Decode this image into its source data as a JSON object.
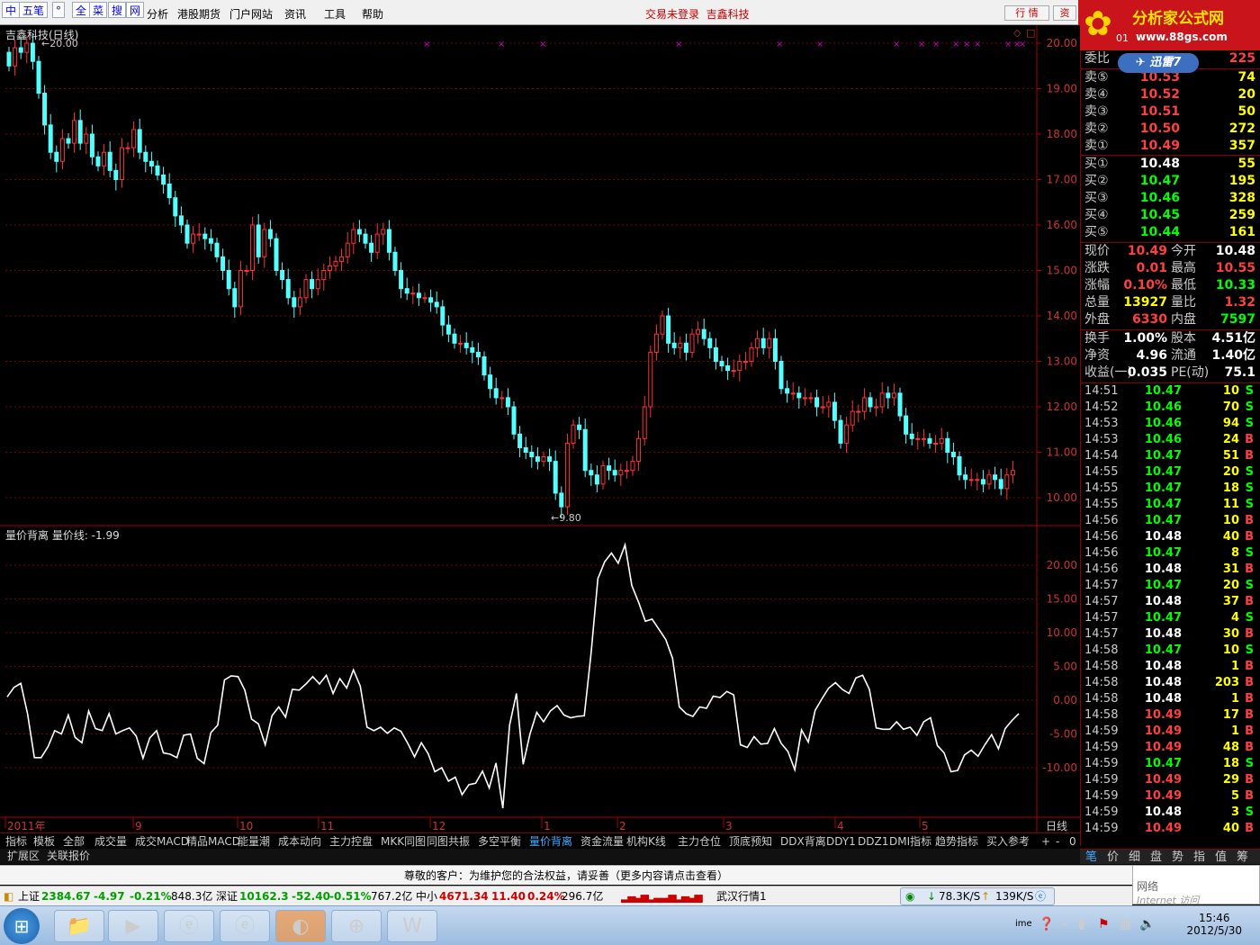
{
  "menubar": {
    "quick_tools": [
      "中",
      "五笔",
      "°",
      "全",
      "菜",
      "搜",
      "网"
    ],
    "menus": [
      "分析",
      "港股期货",
      "门户网站",
      "资讯",
      "工具",
      "帮助"
    ],
    "trade_status": "交易未登录",
    "stock_name": "吉鑫科技",
    "right_buttons": [
      "行 情",
      "资"
    ]
  },
  "brand": {
    "title": "分析家公式网",
    "url": "www.88gs.com",
    "partial_code": "01"
  },
  "xunlei": "迅雷7",
  "main_chart": {
    "title": "吉鑫科技(日线)",
    "high_label": "20.00",
    "low_label": "9.80",
    "y_ticks": [
      "20.00",
      "19.00",
      "18.00",
      "17.00",
      "16.00",
      "15.00",
      "14.00",
      "13.00",
      "12.00",
      "11.00",
      "10.00"
    ],
    "y_values": [
      20,
      19,
      18,
      17,
      16,
      15,
      14,
      13,
      12,
      11,
      10
    ],
    "x_labels": [
      "2011年",
      "9",
      "10",
      "11",
      "12",
      "1",
      "2",
      "3",
      "4",
      "5"
    ],
    "period": "日线"
  },
  "indicator": {
    "title": "量价背离 量价线: -1.99",
    "y_ticks": [
      "20.00",
      "15.00",
      "10.00",
      "5.00",
      "0.00",
      "-5.00",
      "-10.00"
    ],
    "y_values": [
      20,
      15,
      10,
      5,
      0,
      -5,
      -10
    ]
  },
  "chart_data": [
    {
      "type": "candlestick",
      "title": "吉鑫科技(日线)",
      "ylim": [
        9.6,
        20.4
      ],
      "close": [
        19.5,
        19.9,
        19.8,
        20.0,
        19.6,
        18.9,
        18.2,
        17.6,
        17.4,
        17.9,
        17.8,
        18.3,
        17.8,
        18.0,
        17.5,
        17.3,
        17.6,
        17.2,
        17.0,
        17.7,
        17.7,
        18.1,
        17.6,
        17.4,
        17.3,
        17.1,
        16.9,
        16.6,
        16.2,
        16.0,
        15.6,
        15.8,
        15.8,
        15.7,
        15.6,
        15.3,
        15.0,
        14.6,
        14.2,
        15.0,
        15.0,
        16.0,
        15.3,
        15.9,
        15.7,
        15.0,
        14.8,
        14.4,
        14.2,
        14.4,
        14.8,
        14.6,
        14.8,
        15.0,
        15.1,
        15.2,
        15.3,
        15.6,
        15.9,
        15.8,
        15.6,
        15.4,
        15.8,
        15.9,
        15.4,
        15.0,
        14.6,
        14.5,
        14.5,
        14.4,
        14.4,
        14.3,
        14.2,
        13.8,
        13.6,
        13.4,
        13.4,
        13.3,
        13.2,
        13.1,
        12.7,
        12.4,
        12.2,
        12.2,
        12.0,
        11.4,
        11.1,
        11.0,
        10.9,
        10.8,
        10.9,
        10.8,
        10.1,
        9.8,
        11.2,
        11.6,
        11.5,
        10.6,
        10.5,
        10.3,
        10.7,
        10.6,
        10.5,
        10.6,
        10.6,
        10.8,
        11.3,
        12.0,
        13.2,
        13.6,
        14.0,
        13.4,
        13.3,
        13.4,
        13.2,
        13.6,
        13.7,
        13.5,
        13.3,
        13.0,
        12.9,
        12.8,
        12.8,
        13.0,
        13.0,
        13.3,
        13.5,
        13.3,
        13.5,
        13.0,
        12.4,
        12.3,
        12.3,
        12.2,
        12.2,
        12.2,
        12.0,
        12.0,
        12.1,
        11.7,
        11.2,
        11.6,
        11.9,
        11.9,
        12.2,
        12.0,
        12.0,
        12.3,
        12.2,
        12.3,
        11.8,
        11.4,
        11.3,
        11.3,
        11.3,
        11.2,
        11.2,
        11.3,
        11.0,
        10.9,
        10.5,
        10.4,
        10.4,
        10.4,
        10.3,
        10.5,
        10.4,
        10.2,
        10.5,
        10.6
      ],
      "min_price": 9.8,
      "max_price": 20.0
    },
    {
      "type": "line",
      "title": "量价背离",
      "series": [
        {
          "name": "量价线",
          "values": [
            0.5,
            1.9,
            2.5,
            -2,
            -8.5,
            -8.5,
            -6.9,
            -4.5,
            -5,
            -2.2,
            -5.5,
            -6.3,
            -1.6,
            -4.2,
            -4.5,
            -2,
            -5,
            -4.5,
            -4.1,
            -5.3,
            -8.6,
            -5.6,
            -4.5,
            -7.8,
            -8,
            -8.5,
            -5.2,
            -5,
            -8.6,
            -9.4,
            -4.8,
            -3.7,
            3,
            3.6,
            3.5,
            1.5,
            -2.8,
            -3.5,
            -6.6,
            -2.3,
            -1,
            -2.5,
            1.6,
            1.5,
            2.4,
            3.5,
            2.4,
            3.7,
            1,
            3.2,
            1.8,
            4.5,
            2.1,
            -4,
            -4.5,
            -4,
            -4.9,
            -4.1,
            -4.6,
            -6.4,
            -8.4,
            -6.3,
            -7.9,
            -10.6,
            -10,
            -12,
            -11.4,
            -14,
            -12.5,
            -12.3,
            -10.5,
            -13,
            -9.3,
            -16,
            -3.7,
            1,
            -9.5,
            -5,
            -1.8,
            -3.2,
            -1.6,
            -0.8,
            -2.2,
            -2.6,
            -2.4,
            -2.3,
            7,
            18,
            20.5,
            21.8,
            20.3,
            23,
            17,
            14.5,
            11.7,
            12,
            10.5,
            9,
            6.2,
            -1,
            -2,
            -2.4,
            -1,
            -1.2,
            0.6,
            0.4,
            1.3,
            0.8,
            -6.6,
            -7,
            -5.4,
            -6.5,
            -6.4,
            -4.2,
            -6.4,
            -7.6,
            -10.3,
            -4.4,
            -6.2,
            -1.5,
            0.2,
            1.8,
            2.6,
            1.6,
            1,
            3.3,
            3.7,
            1.6,
            -4.1,
            -4.3,
            -4.3,
            -3.2,
            -4.3,
            -4,
            -5.2,
            -3.2,
            -2.6,
            -6.7,
            -7.8,
            -10.6,
            -10.4,
            -8.1,
            -7.4,
            -8.3,
            -6.6,
            -5.1,
            -7.2,
            -4.2,
            -3,
            -1.99
          ]
        }
      ],
      "ylim": [
        -16,
        24
      ]
    }
  ],
  "quote_panel": {
    "weibi": {
      "label": "委比",
      "value": "225"
    },
    "asks": [
      {
        "label": "卖⑤",
        "price": "10.53",
        "vol": "74"
      },
      {
        "label": "卖④",
        "price": "10.52",
        "vol": "20"
      },
      {
        "label": "卖③",
        "price": "10.51",
        "vol": "50"
      },
      {
        "label": "卖②",
        "price": "10.50",
        "vol": "272"
      },
      {
        "label": "卖①",
        "price": "10.49",
        "vol": "357"
      }
    ],
    "bids": [
      {
        "label": "买①",
        "price": "10.48",
        "vol": "55",
        "color": "#ffffff"
      },
      {
        "label": "买②",
        "price": "10.47",
        "vol": "195",
        "color": "#00ff00"
      },
      {
        "label": "买③",
        "price": "10.46",
        "vol": "328",
        "color": "#00ff00"
      },
      {
        "label": "买④",
        "price": "10.45",
        "vol": "259",
        "color": "#00ff00"
      },
      {
        "label": "买⑤",
        "price": "10.44",
        "vol": "161",
        "color": "#00ff00"
      }
    ],
    "stats": [
      {
        "l1": "现价",
        "v1": "10.49",
        "c1": "#ff4040",
        "l2": "今开",
        "v2": "10.48",
        "c2": "#ffffff"
      },
      {
        "l1": "涨跌",
        "v1": "0.01",
        "c1": "#ff4040",
        "l2": "最高",
        "v2": "10.55",
        "c2": "#ff4040"
      },
      {
        "l1": "涨幅",
        "v1": "0.10%",
        "c1": "#ff4040",
        "l2": "最低",
        "v2": "10.33",
        "c2": "#00ff00"
      },
      {
        "l1": "总量",
        "v1": "13927",
        "c1": "#ffff00",
        "l2": "量比",
        "v2": "1.32",
        "c2": "#ff4040"
      },
      {
        "l1": "外盘",
        "v1": "6330",
        "c1": "#ff4040",
        "l2": "内盘",
        "v2": "7597",
        "c2": "#00ff00"
      }
    ],
    "fundamentals": [
      {
        "l1": "换手",
        "v1": "1.00%",
        "l2": "股本",
        "v2": "4.51亿"
      },
      {
        "l1": "净资",
        "v1": "4.96",
        "l2": "流通",
        "v2": "1.40亿"
      },
      {
        "l1": "收益(一)",
        "v1": "0.035",
        "l2": "PE(动)",
        "v2": "75.1"
      }
    ],
    "ticks": [
      {
        "t": "14:51",
        "p": "10.47",
        "v": "10",
        "d": "S"
      },
      {
        "t": "14:52",
        "p": "10.46",
        "v": "70",
        "d": "S"
      },
      {
        "t": "14:53",
        "p": "10.46",
        "v": "94",
        "d": "S"
      },
      {
        "t": "14:53",
        "p": "10.46",
        "v": "24",
        "d": "B"
      },
      {
        "t": "14:54",
        "p": "10.47",
        "v": "51",
        "d": "B"
      },
      {
        "t": "14:55",
        "p": "10.47",
        "v": "20",
        "d": "S"
      },
      {
        "t": "14:55",
        "p": "10.47",
        "v": "18",
        "d": "S"
      },
      {
        "t": "14:55",
        "p": "10.47",
        "v": "11",
        "d": "S"
      },
      {
        "t": "14:56",
        "p": "10.47",
        "v": "10",
        "d": "B"
      },
      {
        "t": "14:56",
        "p": "10.48",
        "v": "40",
        "d": "B"
      },
      {
        "t": "14:56",
        "p": "10.47",
        "v": "8",
        "d": "S"
      },
      {
        "t": "14:56",
        "p": "10.48",
        "v": "31",
        "d": "B"
      },
      {
        "t": "14:57",
        "p": "10.47",
        "v": "20",
        "d": "S"
      },
      {
        "t": "14:57",
        "p": "10.48",
        "v": "37",
        "d": "B"
      },
      {
        "t": "14:57",
        "p": "10.47",
        "v": "4",
        "d": "S"
      },
      {
        "t": "14:57",
        "p": "10.48",
        "v": "30",
        "d": "B"
      },
      {
        "t": "14:58",
        "p": "10.47",
        "v": "10",
        "d": "S"
      },
      {
        "t": "14:58",
        "p": "10.48",
        "v": "1",
        "d": "B"
      },
      {
        "t": "14:58",
        "p": "10.48",
        "v": "203",
        "d": "B"
      },
      {
        "t": "14:58",
        "p": "10.48",
        "v": "1",
        "d": "B"
      },
      {
        "t": "14:58",
        "p": "10.49",
        "v": "17",
        "d": "B"
      },
      {
        "t": "14:59",
        "p": "10.49",
        "v": "1",
        "d": "B"
      },
      {
        "t": "14:59",
        "p": "10.49",
        "v": "48",
        "d": "B"
      },
      {
        "t": "14:59",
        "p": "10.47",
        "v": "18",
        "d": "S"
      },
      {
        "t": "14:59",
        "p": "10.49",
        "v": "29",
        "d": "B"
      },
      {
        "t": "14:59",
        "p": "10.49",
        "v": "5",
        "d": "B"
      },
      {
        "t": "14:59",
        "p": "10.48",
        "v": "3",
        "d": "S"
      },
      {
        "t": "14:59",
        "p": "10.49",
        "v": "40",
        "d": "B"
      }
    ],
    "tabs": [
      "笔",
      "价",
      "细",
      "盘",
      "势",
      "指",
      "值",
      "筹"
    ]
  },
  "indicator_tabs": [
    "指标",
    "模板",
    "全部",
    "成交量",
    "成交MACD",
    "精品MACD",
    "能量潮",
    "成本动向",
    "主力控盘",
    "MKK同图",
    "同图共振",
    "多空平衡",
    "量价背离",
    "资金流量",
    "机构K线",
    "主力仓位",
    "顶底预知",
    "DDX背离",
    "DDY1",
    "DDZ1",
    "DMI指标",
    "趋势指标",
    "买入参考"
  ],
  "active_tab": "量价背离",
  "tab_controls": [
    "+",
    "-",
    "0"
  ],
  "sub_tabs": [
    "扩展区",
    "关联报价"
  ],
  "notice": "尊敬的客户：为维护您的合法权益，请妥善（更多内容请点击查看）",
  "network": {
    "label": "网络",
    "hint": "Internet 访问"
  },
  "status_bar": {
    "sh": {
      "name": "上证",
      "value": "2384.67",
      "chg": "-4.97",
      "pct": "-0.21%",
      "amt": "848.3亿"
    },
    "sz": {
      "name": "深证",
      "value": "10162.3",
      "chg": "-52.40",
      "pct": "-0.51%",
      "amt": "767.2亿"
    },
    "zx": {
      "name": "中小",
      "value": "4671.34",
      "chg": "11.40",
      "pct": "0.24%",
      "amt": "296.7亿"
    },
    "extra": "武汉行情1",
    "down_speed": "78.3K/S",
    "up_speed": "139K/S"
  },
  "taskbar": {
    "time": "15:46",
    "date": "2012/5/30",
    "ime": "ime"
  }
}
